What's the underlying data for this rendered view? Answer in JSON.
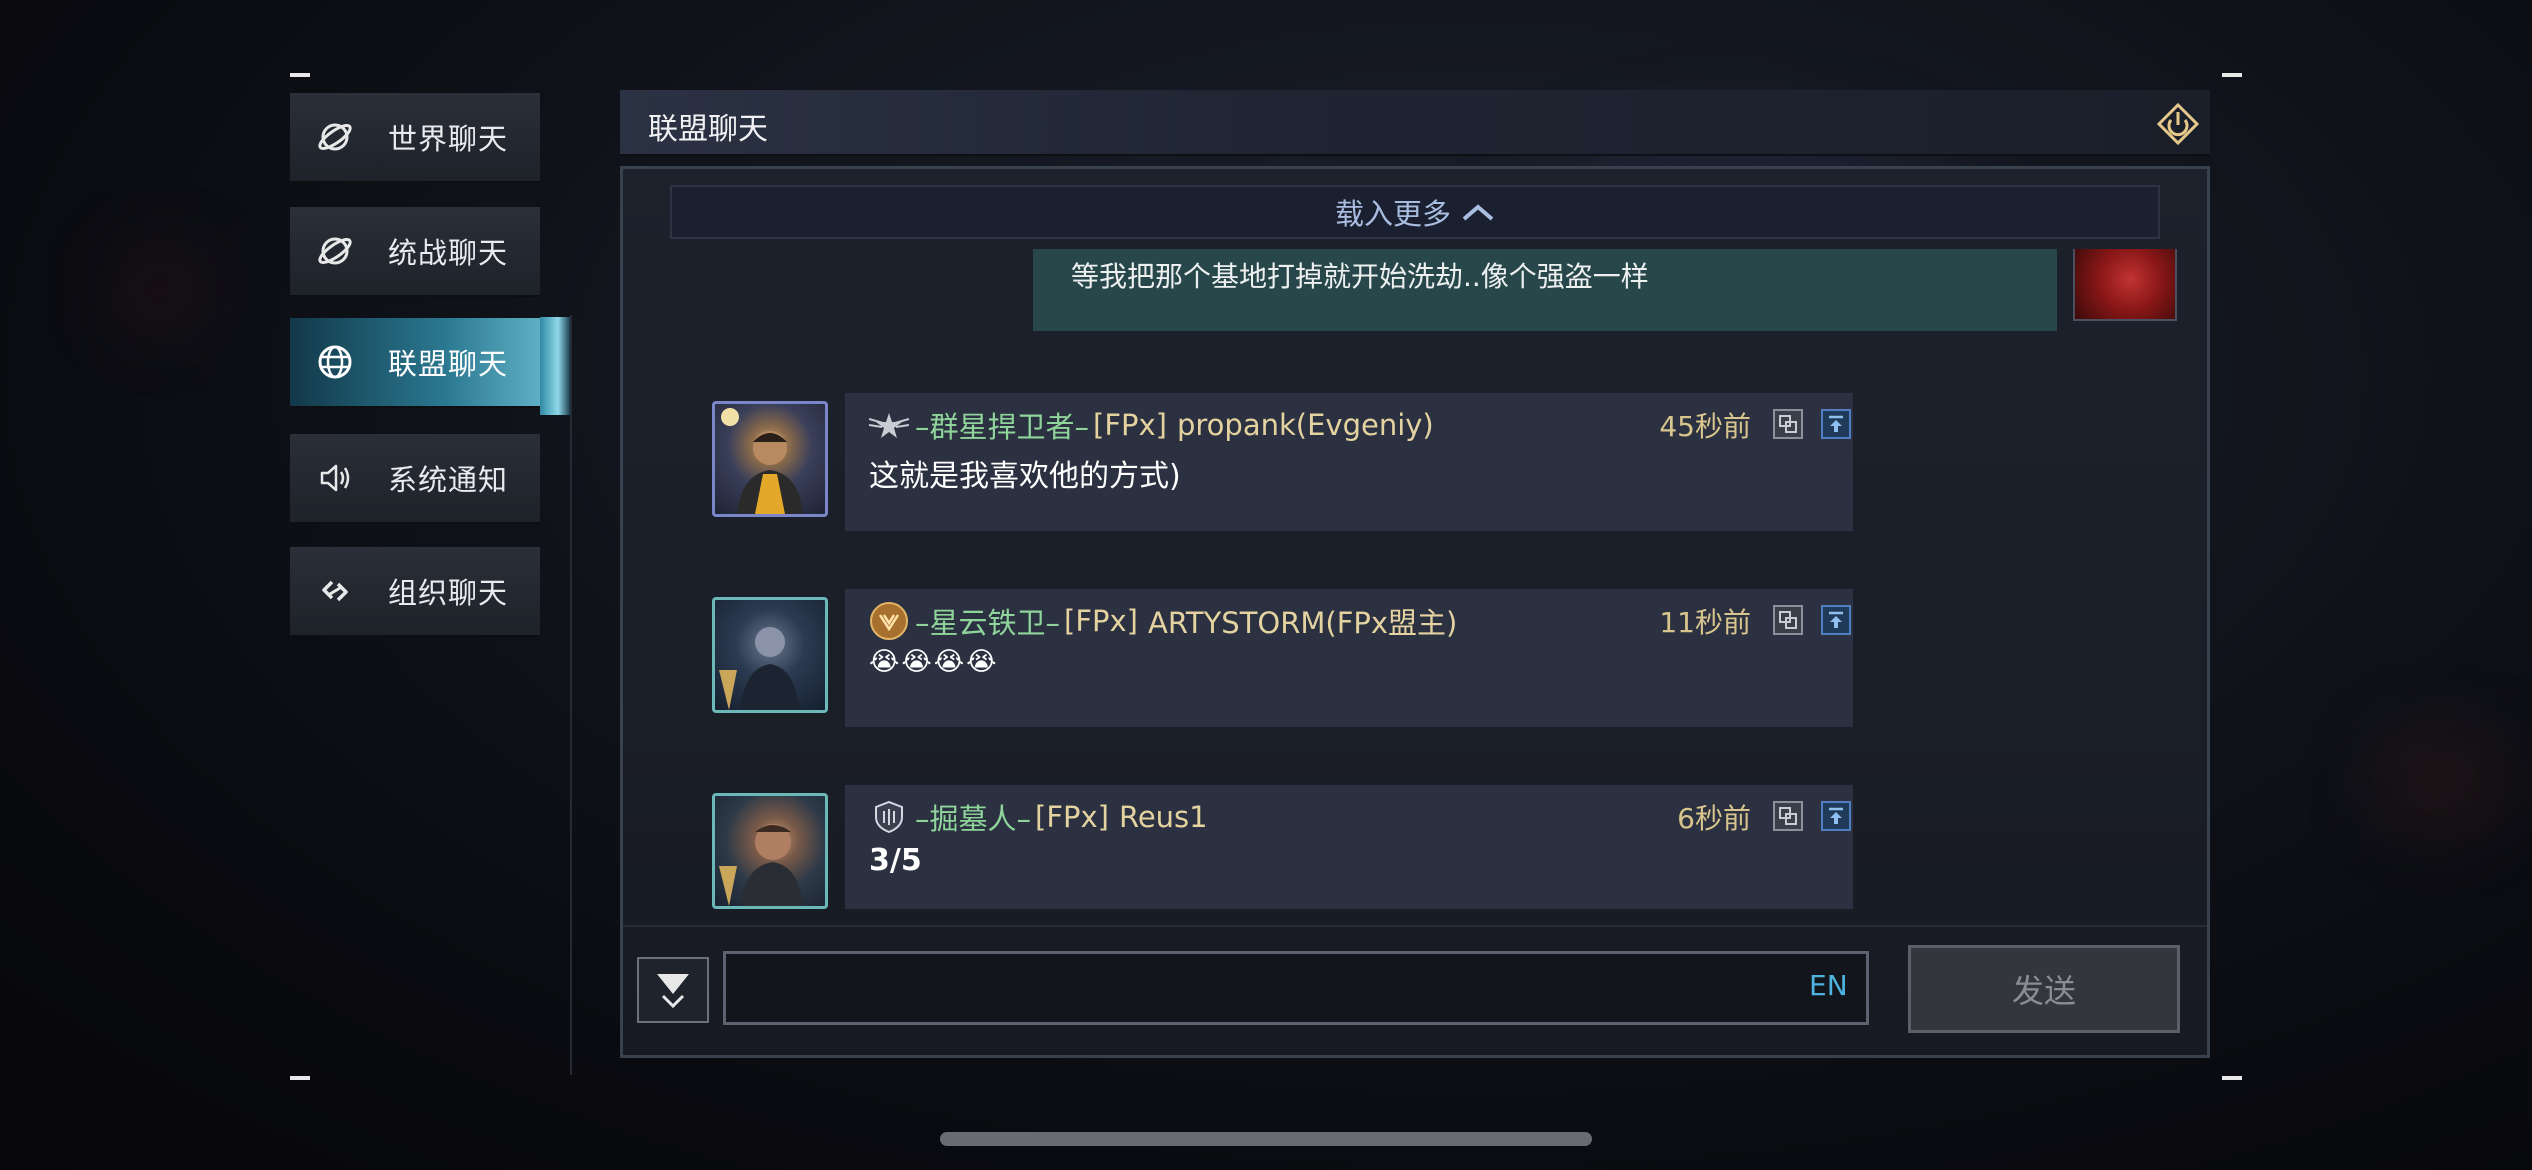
{
  "sidebar": {
    "items": [
      {
        "label": "世界聊天",
        "icon": "planet-icon",
        "active": false
      },
      {
        "label": "统战聊天",
        "icon": "planet-icon",
        "active": false
      },
      {
        "label": "联盟聊天",
        "icon": "globe-icon",
        "active": true
      },
      {
        "label": "系统通知",
        "icon": "speaker-icon",
        "active": false
      },
      {
        "label": "组织聊天",
        "icon": "link-icon",
        "active": false
      }
    ]
  },
  "header": {
    "title": "联盟聊天",
    "power_icon": "power-icon"
  },
  "chat": {
    "load_more": "载入更多",
    "own_message": {
      "text": "等我把那个基地打掉就开始洗劫..像个强盗一样"
    },
    "messages": [
      {
        "title": "–群星捍卫者–",
        "tag": "[FPx]",
        "name": "propank(Evgeniy)",
        "time": "45秒前",
        "text": "这就是我喜欢他的方式)"
      },
      {
        "title": "–星云铁卫–",
        "tag": "[FPx]",
        "name": "ARTYSTORM(FPx盟主)",
        "time": "11秒前",
        "text": "😭😭😭😭"
      },
      {
        "title": "–掘墓人–",
        "tag": "[FPx]",
        "name": "Reus1",
        "time": "6秒前",
        "text": "3/5"
      }
    ]
  },
  "input": {
    "value": "",
    "lang": "EN",
    "send_label": "发送"
  },
  "colors": {
    "accent_teal": "#4fb3df",
    "title_green": "#8fd49a",
    "name_gold": "#e4d2a0",
    "time_gold": "#d8c58e"
  }
}
